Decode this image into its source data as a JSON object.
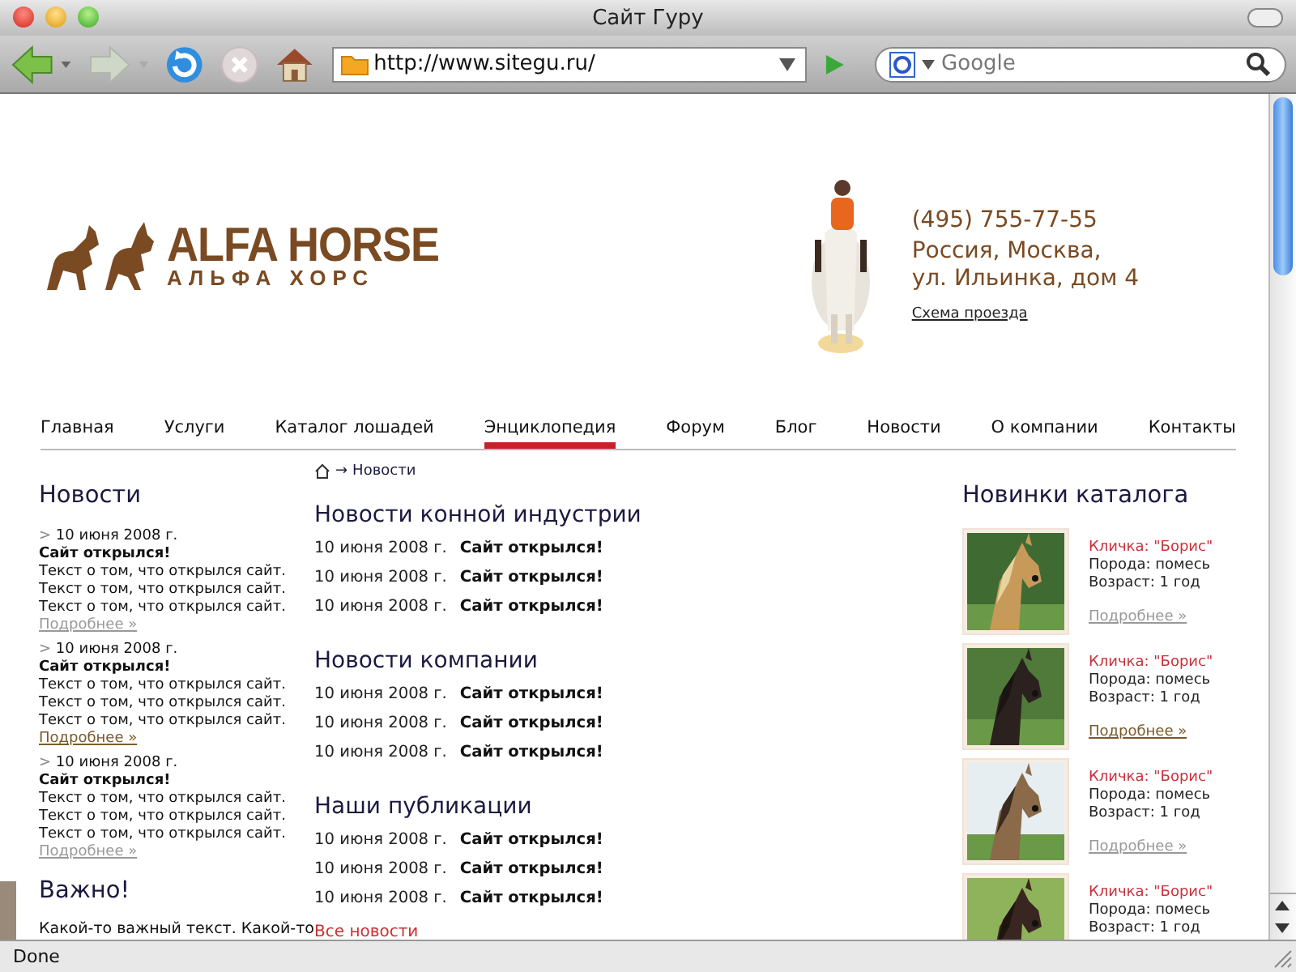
{
  "window": {
    "title": "Сайт Гуру"
  },
  "toolbar": {
    "address": "http://www.sitegu.ru/",
    "search_placeholder": "Google"
  },
  "header": {
    "logo": {
      "title": "ALFA HORSE",
      "subtitle": "АЛЬФА ХОРС"
    },
    "contact": {
      "phone": "(495) 755-77-55",
      "address_lines": [
        "Россия, Москва,",
        "ул. Ильинка, дом 4"
      ],
      "map_link": "Схема проезда"
    }
  },
  "nav": [
    {
      "label": "Главная",
      "selected": false
    },
    {
      "label": "Услуги",
      "selected": false
    },
    {
      "label": "Каталог лошадей",
      "selected": false
    },
    {
      "label": "Энциклопедия",
      "selected": true
    },
    {
      "label": "Форум",
      "selected": false
    },
    {
      "label": "Блог",
      "selected": false
    },
    {
      "label": "Новости",
      "selected": false
    },
    {
      "label": "О компании",
      "selected": false
    },
    {
      "label": "Контакты",
      "selected": false
    }
  ],
  "news": {
    "title": "Новости",
    "items": [
      {
        "marker": ">",
        "date": "10 июня 2008 г.",
        "headline": "Сайт открылся!",
        "lines": [
          "Текст о том, что открылся сайт.",
          "Текст о том, что открылся сайт.",
          "Текст о том, что открылся сайт."
        ],
        "more": "Подробнее »",
        "hovered": false
      },
      {
        "marker": ">",
        "date": "10 июня 2008 г.",
        "headline": "Сайт открылся!",
        "lines": [
          "Текст о том, что открылся сайт.",
          "Текст о том, что открылся сайт.",
          "Текст о том, что открылся сайт."
        ],
        "more": "Подробнее »",
        "hovered": true
      },
      {
        "marker": ">",
        "date": "10 июня 2008 г.",
        "headline": "Сайт открылся!",
        "lines": [
          "Текст о том, что открылся сайт.",
          "Текст о том, что открылся сайт.",
          "Текст о том, что открылся сайт."
        ],
        "more": "Подробнее »",
        "hovered": false
      }
    ]
  },
  "important": {
    "title": "Важно!",
    "text": "Какой-то важный текст.  Какой-то"
  },
  "breadcrumb": {
    "separator": "→",
    "current": "Новости"
  },
  "sections": [
    {
      "title": "Новости конной индустрии",
      "rows": [
        {
          "date": "10 июня 2008 г.",
          "headline": "Сайт открылся!"
        },
        {
          "date": "10 июня 2008 г.",
          "headline": "Сайт открылся!"
        },
        {
          "date": "10 июня 2008 г.",
          "headline": "Сайт открылся!"
        }
      ]
    },
    {
      "title": "Новости компании",
      "rows": [
        {
          "date": "10 июня 2008 г.",
          "headline": "Сайт открылся!"
        },
        {
          "date": "10 июня 2008 г.",
          "headline": "Сайт открылся!"
        },
        {
          "date": "10 июня 2008 г.",
          "headline": "Сайт открылся!"
        }
      ]
    },
    {
      "title": "Наши публикации",
      "rows": [
        {
          "date": "10 июня 2008 г.",
          "headline": "Сайт открылся!"
        },
        {
          "date": "10 июня 2008 г.",
          "headline": "Сайт открылся!"
        },
        {
          "date": "10 июня 2008 г.",
          "headline": "Сайт открылся!"
        }
      ]
    }
  ],
  "all_news": "Все новости",
  "catalog": {
    "title": "Новинки каталога",
    "items": [
      {
        "name": "Кличка: \"Борис\"",
        "breed": "Порода: помесь",
        "age": "Возраст:  1 год",
        "more": "Подробнее »",
        "hovered": false
      },
      {
        "name": "Кличка: \"Борис\"",
        "breed": "Порода: помесь",
        "age": "Возраст:  1 год",
        "more": "Подробнее »",
        "hovered": true
      },
      {
        "name": "Кличка: \"Борис\"",
        "breed": "Порода: помесь",
        "age": "Возраст:  1 год",
        "more": "Подробнее »",
        "hovered": false
      },
      {
        "name": "Кличка: \"Борис\"",
        "breed": "Порода: помесь",
        "age": "Возраст:  1 год"
      }
    ]
  },
  "status_bar": "Done"
}
